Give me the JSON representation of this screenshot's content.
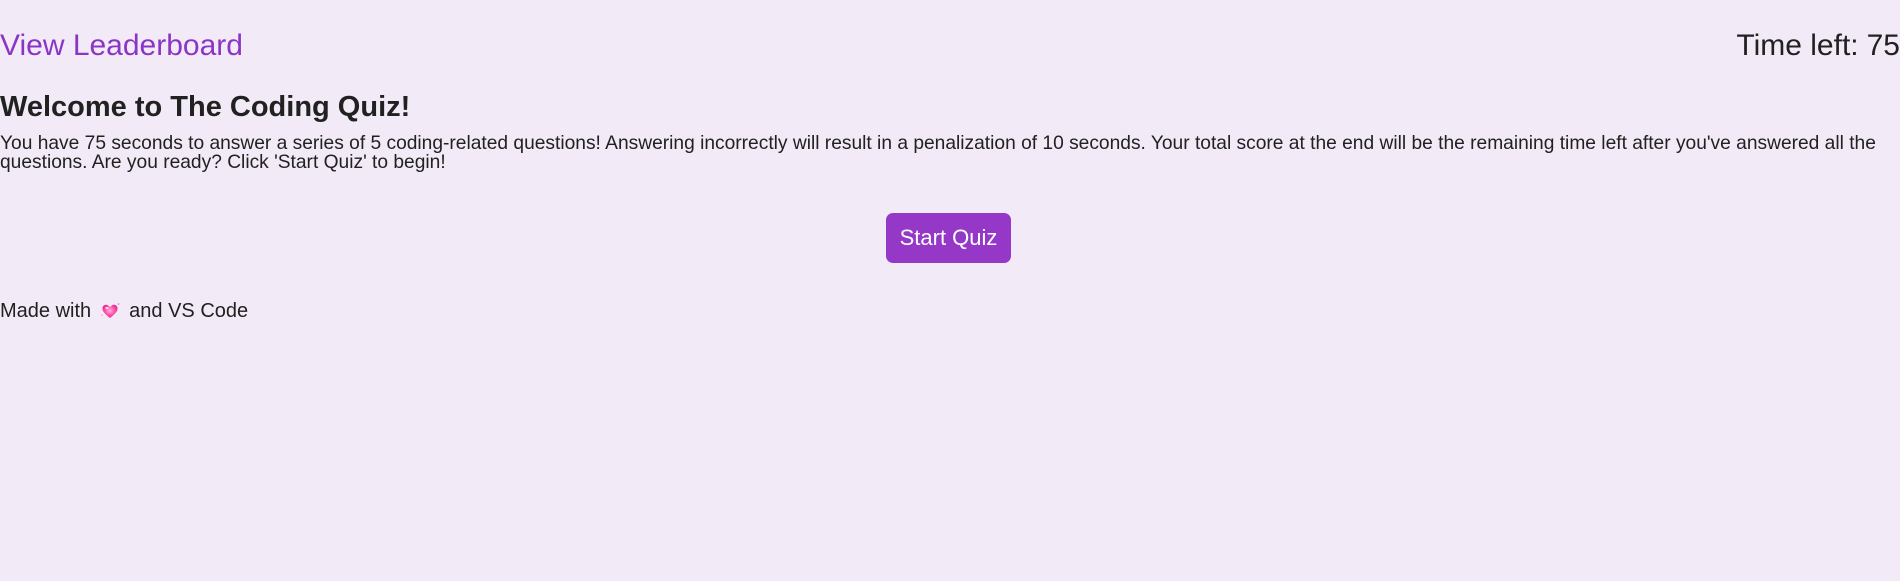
{
  "header": {
    "leaderboard_link": "View Leaderboard",
    "timer_label": "Time left:",
    "timer_value": "75"
  },
  "main": {
    "title": "Welcome to The Coding Quiz!",
    "intro": "You have 75 seconds to answer a series of 5 coding-related questions! Answering incorrectly will result in a penalization of 10 seconds. Your total score at the end will be the remaining time left after you've answered all the questions. Are you ready? Click 'Start Quiz' to begin!",
    "start_button": "Start Quiz"
  },
  "footer": {
    "text_before": "Made with",
    "heart_icon": "sparkling-heart-icon",
    "text_after": "and VS Code"
  },
  "colors": {
    "background": "#f2ebf7",
    "accent": "#9538c8",
    "link": "#8a35c6",
    "text": "#212121"
  }
}
